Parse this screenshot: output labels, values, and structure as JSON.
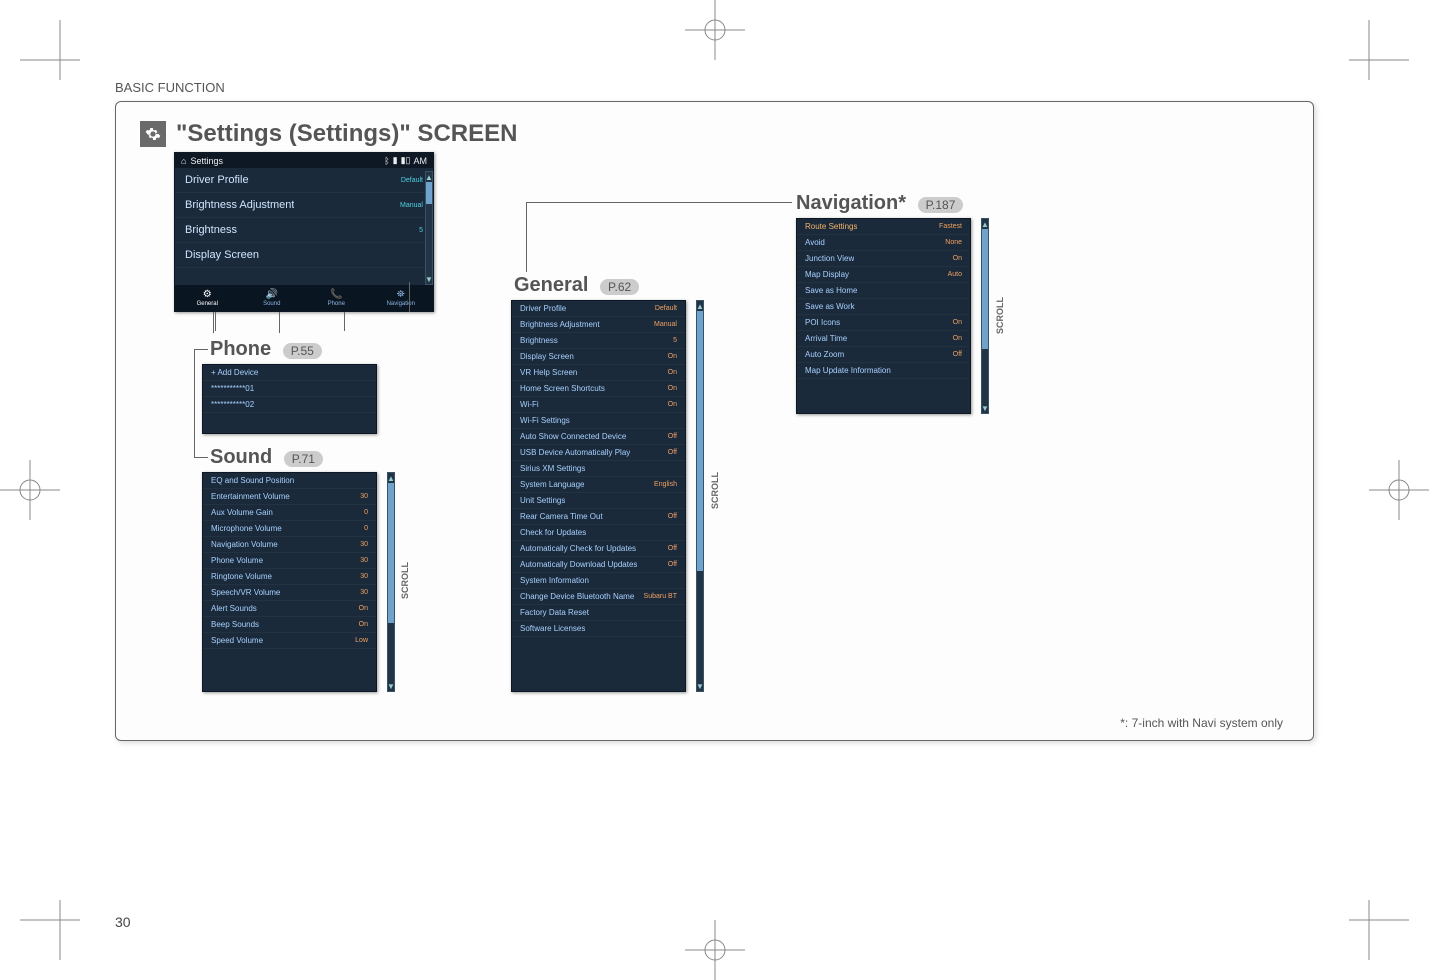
{
  "header": {
    "section": "BASIC FUNCTION"
  },
  "title": {
    "icon_name": "gear-icon",
    "text": "\"Settings (Settings)\" SCREEN"
  },
  "page_number": "30",
  "footnote": "*: 7-inch with Navi system only",
  "settings_panel": {
    "topbar": {
      "home_icon": "home-icon",
      "title": "Settings",
      "status": "AM",
      "bt_icon": "bluetooth-icon",
      "batt_icon": "battery-icon",
      "sig_icon": "signal-icon"
    },
    "rows": [
      {
        "label": "Driver Profile",
        "value": "Default"
      },
      {
        "label": "Brightness Adjustment",
        "value": "Manual"
      },
      {
        "label": "Brightness",
        "value": "5"
      },
      {
        "label": "Display Screen",
        "value": ""
      }
    ],
    "tabs": [
      {
        "icon": "gear-icon",
        "label": "General"
      },
      {
        "icon": "speaker-icon",
        "label": "Sound"
      },
      {
        "icon": "phone-icon",
        "label": "Phone"
      },
      {
        "icon": "nav-icon",
        "label": "Navigation"
      }
    ]
  },
  "phone_block": {
    "heading": "Phone",
    "page_ref": "P.55",
    "rows": [
      {
        "label": "+ Add Device",
        "value": ""
      },
      {
        "label": "***********01",
        "value": ""
      },
      {
        "label": "***********02",
        "value": ""
      }
    ]
  },
  "sound_block": {
    "heading": "Sound",
    "page_ref": "P.71",
    "rows": [
      {
        "label": "EQ and Sound Position",
        "value": ""
      },
      {
        "label": "Entertainment Volume",
        "value": "30"
      },
      {
        "label": "Aux Volume Gain",
        "value": "0"
      },
      {
        "label": "Microphone Volume",
        "value": "0"
      },
      {
        "label": "Navigation Volume",
        "value": "30"
      },
      {
        "label": "Phone Volume",
        "value": "30"
      },
      {
        "label": "Ringtone Volume",
        "value": "30"
      },
      {
        "label": "Speech/VR Volume",
        "value": "30"
      },
      {
        "label": "Alert Sounds",
        "value": "On"
      },
      {
        "label": "Beep Sounds",
        "value": "On"
      },
      {
        "label": "Speed Volume",
        "value": "Low"
      }
    ],
    "scroll_label": "SCROLL"
  },
  "general_block": {
    "heading": "General",
    "page_ref": "P.62",
    "rows": [
      {
        "label": "Driver Profile",
        "value": "Default"
      },
      {
        "label": "Brightness Adjustment",
        "value": "Manual"
      },
      {
        "label": "Brightness",
        "value": "5"
      },
      {
        "label": "Display Screen",
        "value": "On"
      },
      {
        "label": "VR Help Screen",
        "value": "On"
      },
      {
        "label": "Home Screen Shortcuts",
        "value": "On"
      },
      {
        "label": "Wi-Fi",
        "value": "On"
      },
      {
        "label": "Wi-Fi Settings",
        "value": ""
      },
      {
        "label": "Auto Show Connected Device",
        "value": "Off"
      },
      {
        "label": "USB Device Automatically Play",
        "value": "Off"
      },
      {
        "label": "Sirius XM Settings",
        "value": ""
      },
      {
        "label": "System Language",
        "value": "English"
      },
      {
        "label": "Unit Settings",
        "value": ""
      },
      {
        "label": "Rear Camera Time Out",
        "value": "Off"
      },
      {
        "label": "Check for Updates",
        "value": ""
      },
      {
        "label": "Automatically Check for Updates",
        "value": "Off"
      },
      {
        "label": "Automatically Download Updates",
        "value": "Off"
      },
      {
        "label": "System Information",
        "value": ""
      },
      {
        "label": "Change Device Bluetooth Name",
        "value": "Subaru BT"
      },
      {
        "label": "Factory Data Reset",
        "value": ""
      },
      {
        "label": "Software Licenses",
        "value": ""
      }
    ],
    "scroll_label": "SCROLL"
  },
  "navigation_block": {
    "heading": "Navigation*",
    "page_ref": "P.187",
    "rows": [
      {
        "label": "Route Settings",
        "value": "Fastest",
        "orange": true
      },
      {
        "label": "Avoid",
        "value": "None"
      },
      {
        "label": "Junction View",
        "value": "On"
      },
      {
        "label": "Map Display",
        "value": "Auto"
      },
      {
        "label": "Save as Home",
        "value": ""
      },
      {
        "label": "Save as Work",
        "value": ""
      },
      {
        "label": "POI Icons",
        "value": "On"
      },
      {
        "label": "Arrival Time",
        "value": "On"
      },
      {
        "label": "Auto Zoom",
        "value": "Off"
      },
      {
        "label": "Map Update Information",
        "value": ""
      }
    ],
    "scroll_label": "SCROLL"
  }
}
